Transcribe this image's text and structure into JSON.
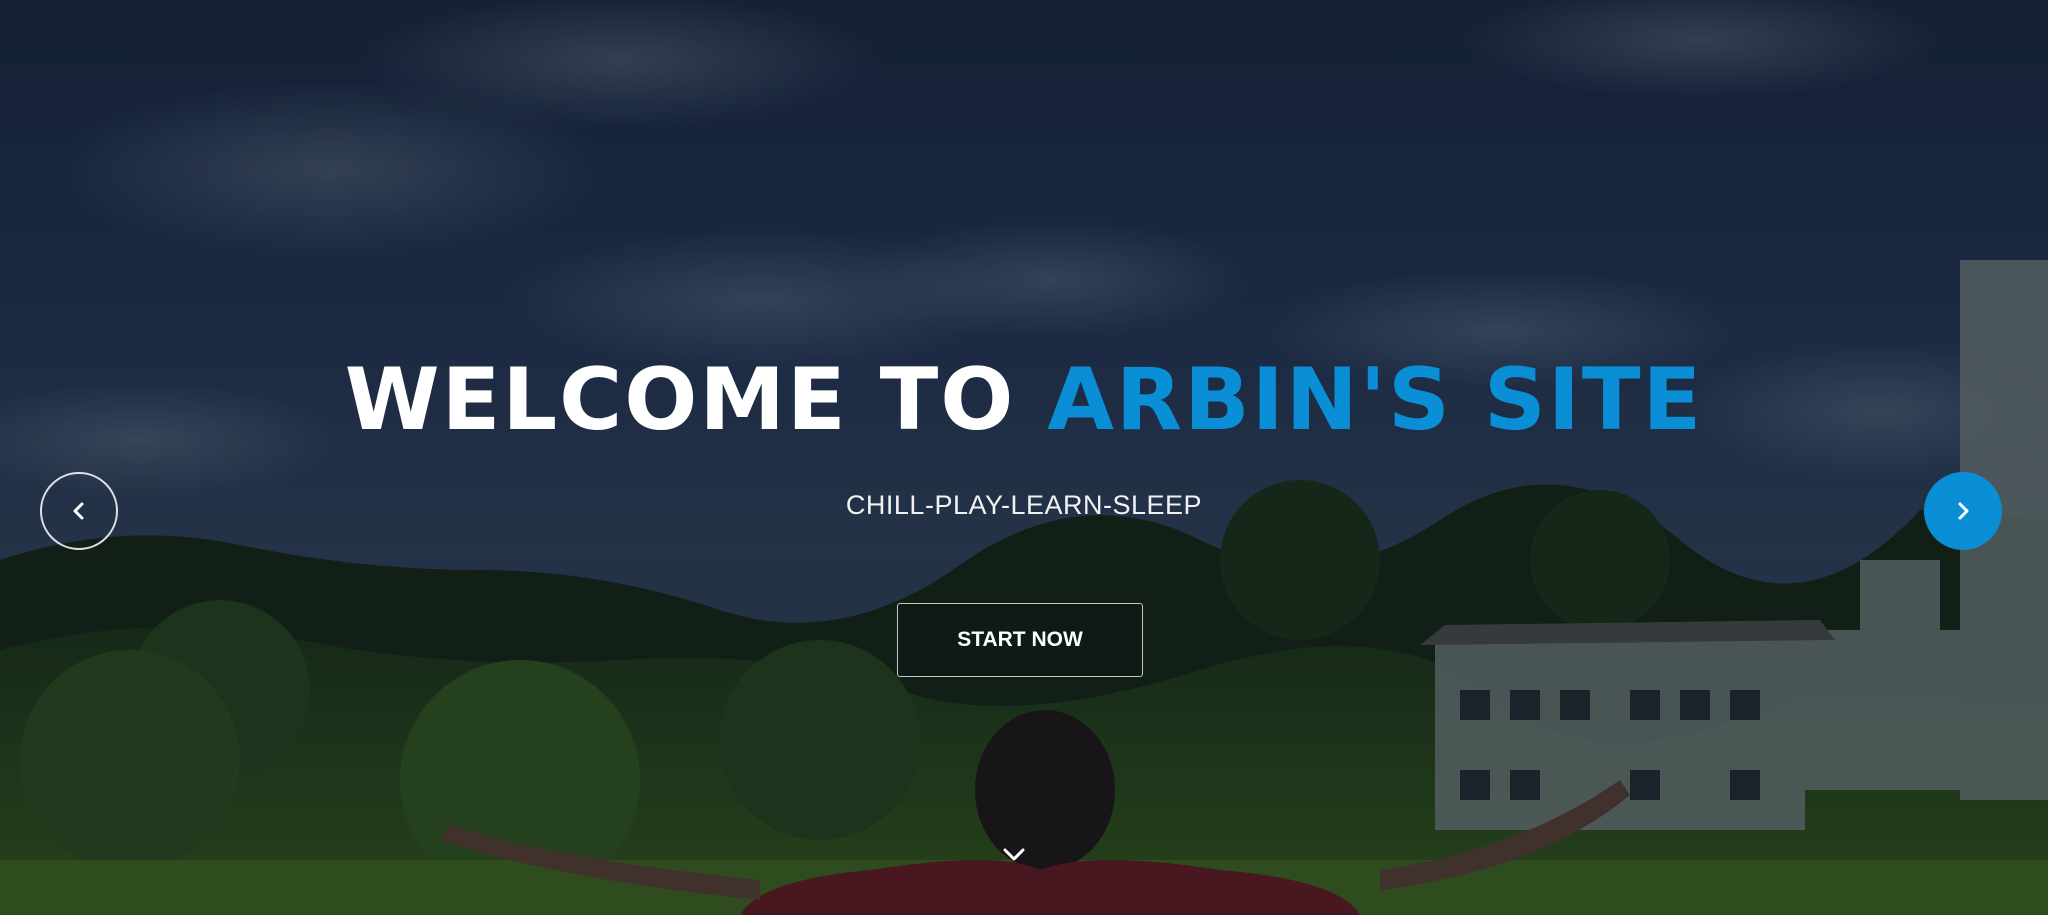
{
  "hero": {
    "headline_main": "WELCOME TO",
    "headline_accent": "ARBIN'S SITE",
    "tagline": "CHILL-PLAY-LEARN-SLEEP",
    "cta_label": "START NOW"
  },
  "controls": {
    "prev_icon": "chevron-left-icon",
    "next_icon": "chevron-right-icon",
    "scroll_icon": "chevron-down-icon"
  },
  "colors": {
    "accent": "#0a8fd6",
    "heading": "#ffffff",
    "overlay": "#0d1a26"
  }
}
